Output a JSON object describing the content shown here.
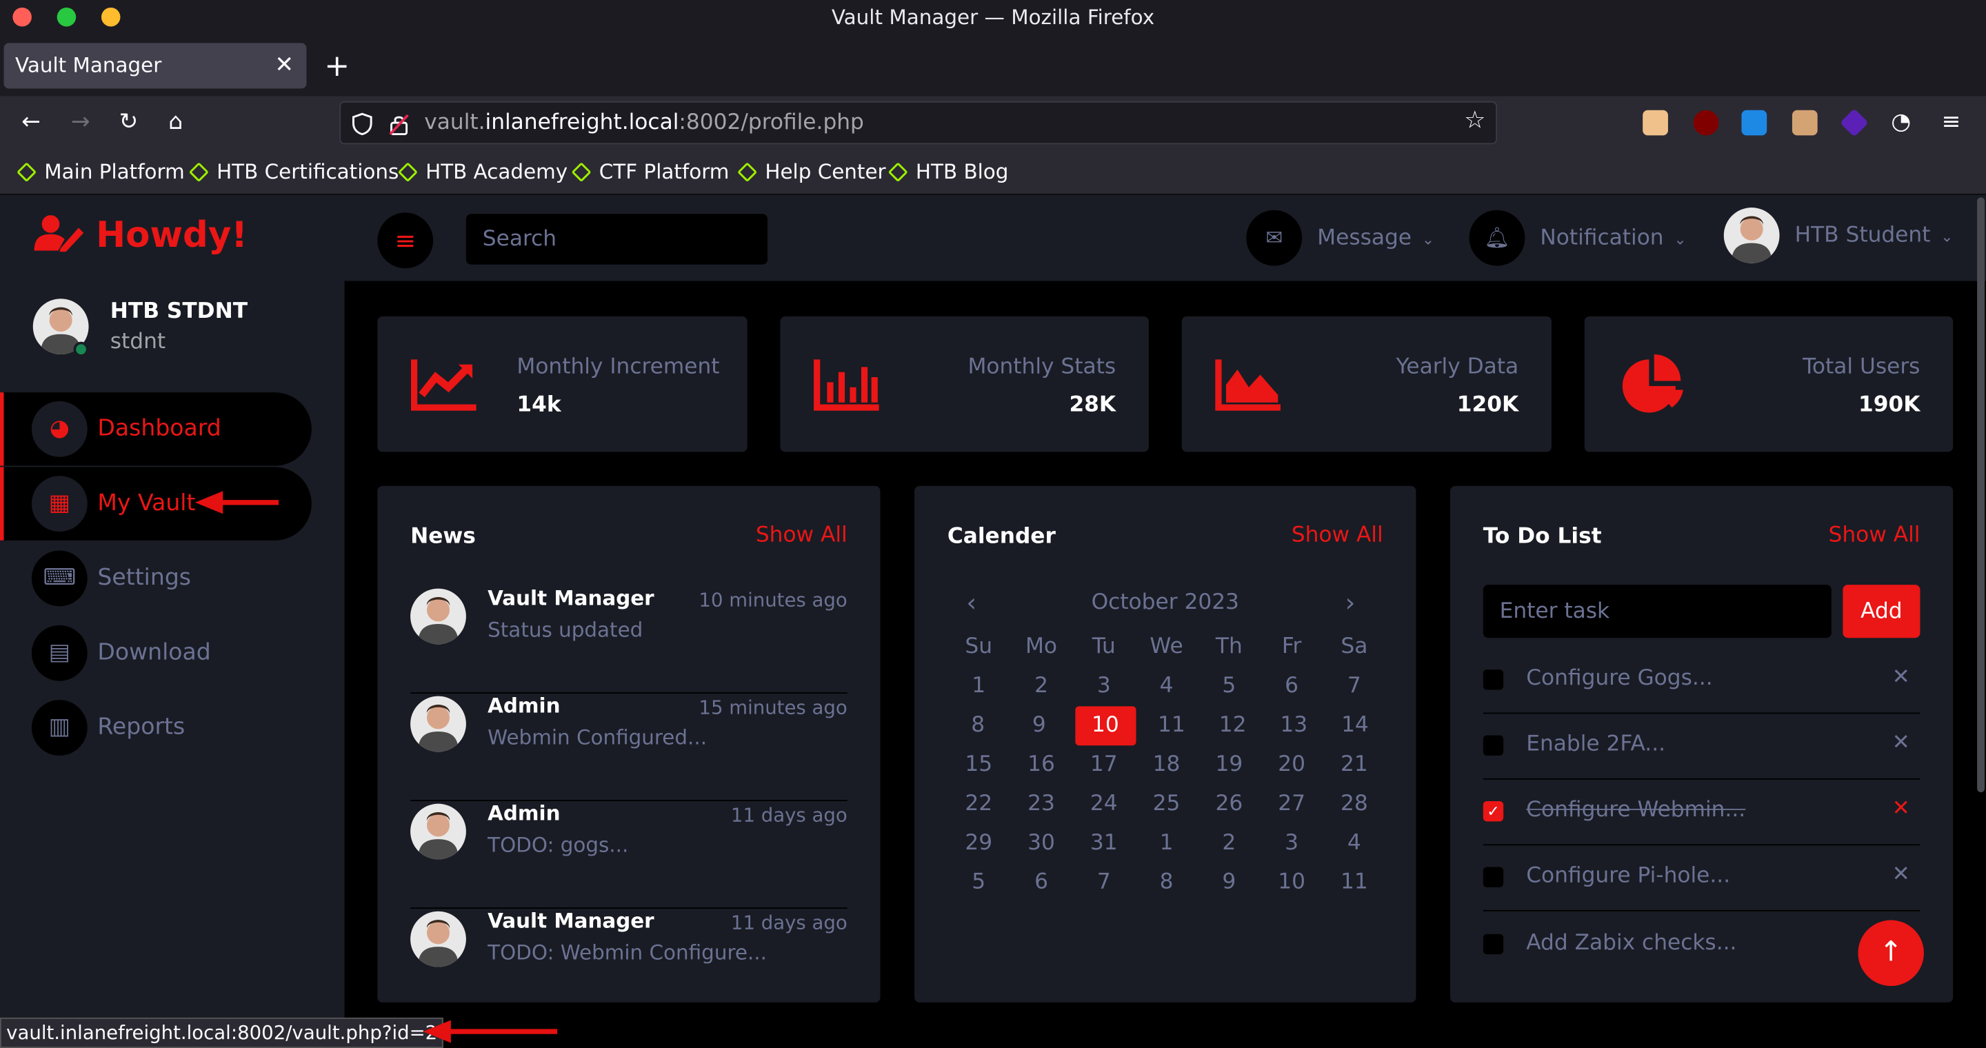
{
  "window": {
    "title": "Vault Manager — Mozilla Firefox"
  },
  "tab": {
    "label": "Vault Manager"
  },
  "url": {
    "host": "vault.",
    "domain": "inlanefreight.local",
    "rest": ":8002/profile.php"
  },
  "bookmarks": [
    "Main Platform",
    "HTB Certifications",
    "HTB Academy",
    "CTF Platform",
    "Help Center",
    "HTB Blog"
  ],
  "brand": {
    "title": "Howdy!"
  },
  "profile": {
    "name": "HTB STDNT",
    "username": "stdnt"
  },
  "sidebar": {
    "items": [
      {
        "label": "Dashboard",
        "icon": "gauge-icon"
      },
      {
        "label": "My Vault",
        "icon": "grid-icon"
      },
      {
        "label": "Settings",
        "icon": "keyboard-icon"
      },
      {
        "label": "Download",
        "icon": "table-icon"
      },
      {
        "label": "Reports",
        "icon": "chart-icon"
      }
    ]
  },
  "topnav": {
    "search_placeholder": "Search",
    "message": "Message",
    "notification": "Notification",
    "user": "HTB Student"
  },
  "stats": [
    {
      "label": "Monthly Increment",
      "value": "14k"
    },
    {
      "label": "Monthly Stats",
      "value": "28K"
    },
    {
      "label": "Yearly Data",
      "value": "120K"
    },
    {
      "label": "Total Users",
      "value": "190K"
    }
  ],
  "news": {
    "title": "News",
    "show_all": "Show All",
    "items": [
      {
        "name": "Vault Manager",
        "time": "10 minutes ago",
        "text": "Status updated"
      },
      {
        "name": "Admin",
        "time": "15 minutes ago",
        "text": "Webmin Configured..."
      },
      {
        "name": "Admin",
        "time": "11 days ago",
        "text": "TODO: gogs..."
      },
      {
        "name": "Vault Manager",
        "time": "11 days ago",
        "text": "TODO: Webmin Configure..."
      }
    ]
  },
  "calendar": {
    "title": "Calender",
    "show_all": "Show All",
    "month": "October 2023",
    "weekdays": [
      "Su",
      "Mo",
      "Tu",
      "We",
      "Th",
      "Fr",
      "Sa"
    ],
    "weeks": [
      [
        "1",
        "2",
        "3",
        "4",
        "5",
        "6",
        "7"
      ],
      [
        "8",
        "9",
        "10",
        "11",
        "12",
        "13",
        "14"
      ],
      [
        "15",
        "16",
        "17",
        "18",
        "19",
        "20",
        "21"
      ],
      [
        "22",
        "23",
        "24",
        "25",
        "26",
        "27",
        "28"
      ],
      [
        "29",
        "30",
        "31",
        "1",
        "2",
        "3",
        "4"
      ],
      [
        "5",
        "6",
        "7",
        "8",
        "9",
        "10",
        "11"
      ]
    ],
    "today": "10"
  },
  "todo": {
    "title": "To Do List",
    "show_all": "Show All",
    "placeholder": "Enter task",
    "add_label": "Add",
    "items": [
      {
        "text": "Configure Gogs...",
        "done": false
      },
      {
        "text": "Enable 2FA...",
        "done": false
      },
      {
        "text": "Configure Webmin...",
        "done": true
      },
      {
        "text": "Configure Pi-hole...",
        "done": false
      },
      {
        "text": "Add Zabix checks...",
        "done": false
      }
    ]
  },
  "status_bar": {
    "text": "vault.inlanefreight.local:8002/vault.php?id=2"
  },
  "colors": {
    "accent": "#eb1616",
    "panel": "#191c24",
    "muted": "#6c7293"
  }
}
